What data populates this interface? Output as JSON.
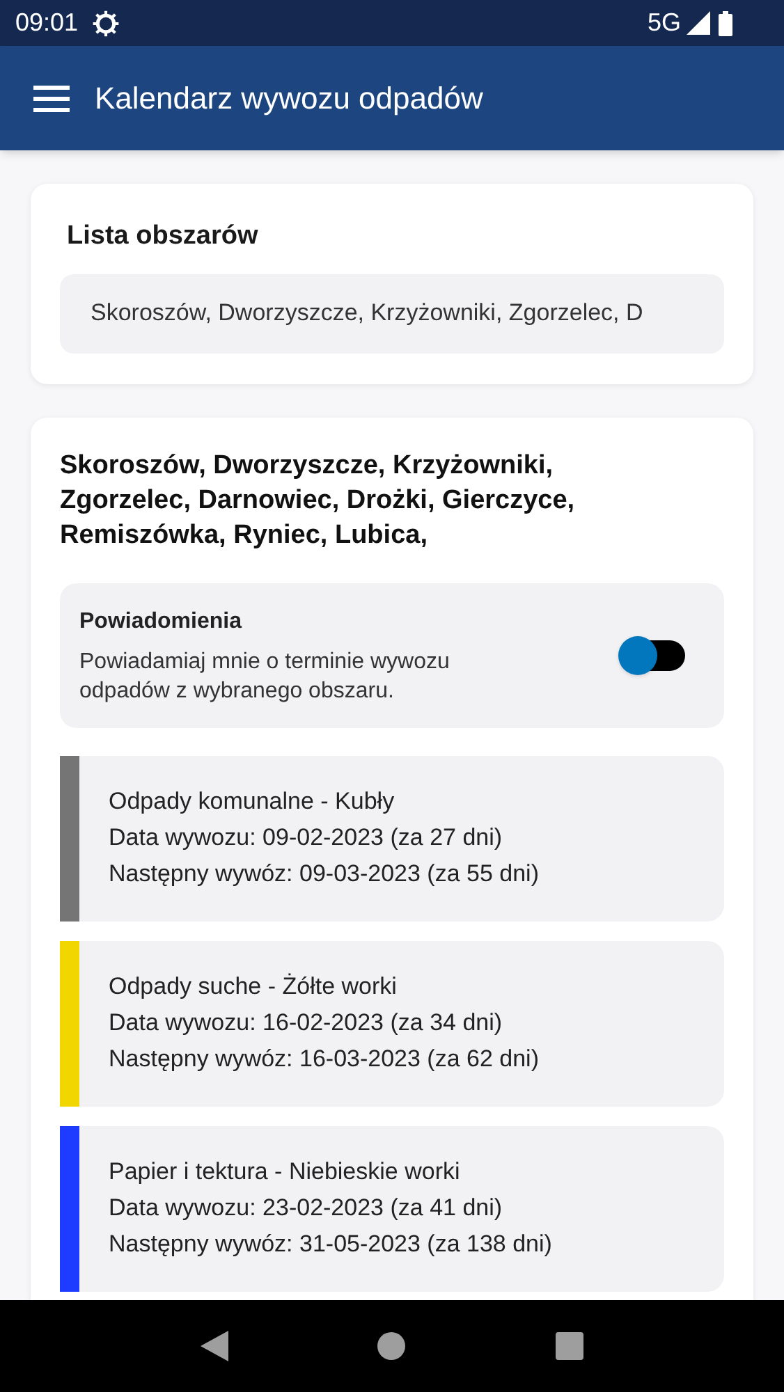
{
  "status_bar": {
    "time": "09:01",
    "network": "5G"
  },
  "app_bar": {
    "title": "Kalendarz wywozu odpadów"
  },
  "areas_card": {
    "title": "Lista obszarów",
    "field_value": "Skoroszów, Dworzyszcze, Krzyżowniki, Zgorzelec, D"
  },
  "detail_card": {
    "heading": "Skoroszów, Dworzyszcze, Krzyżowniki, Zgorzelec, Darnowiec, Drożki, Gierczyce, Remiszówka, Ryniec, Lubica,",
    "notifications": {
      "title": "Powiadomienia",
      "description": "Powiadamiaj mnie o terminie wywozu odpadów z wybranego obszaru.",
      "on": false
    },
    "schedule": [
      {
        "name": "Odpady komunalne - Kubły",
        "date": "Data wywozu: 09-02-2023 (za 27 dni)",
        "next": "Następny wywóz: 09-03-2023 (za 55 dni)",
        "color": "#757575"
      },
      {
        "name": "Odpady suche - Żółte worki",
        "date": "Data wywozu: 16-02-2023 (za 34 dni)",
        "next": "Następny wywóz: 16-03-2023 (za 62 dni)",
        "color": "#f2d600"
      },
      {
        "name": "Papier i tektura - Niebieskie worki",
        "date": "Data wywozu: 23-02-2023 (za 41 dni)",
        "next": "Następny wywóz: 31-05-2023 (za 138 dni)",
        "color": "#1e3cff"
      }
    ]
  }
}
